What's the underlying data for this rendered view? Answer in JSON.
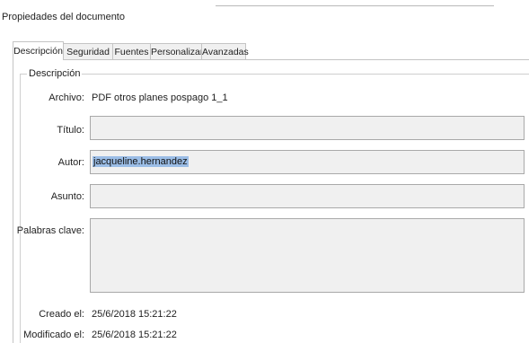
{
  "window": {
    "title": "Propiedades del documento"
  },
  "tabs": [
    {
      "label": "Descripción",
      "active": true
    },
    {
      "label": "Seguridad",
      "active": false
    },
    {
      "label": "Fuentes",
      "active": false
    },
    {
      "label": "Personalizar",
      "active": false
    },
    {
      "label": "Avanzadas",
      "active": false
    }
  ],
  "description": {
    "group_label": "Descripción",
    "archivo_label": "Archivo:",
    "archivo_value": "PDF otros planes pospago 1_1",
    "titulo_label": "Título:",
    "titulo_value": "",
    "autor_label": "Autor:",
    "autor_value": "jacqueline.hernandez",
    "asunto_label": "Asunto:",
    "asunto_value": "",
    "palabras_label": "Palabras clave:",
    "palabras_value": "",
    "creado_label": "Creado el:",
    "creado_value": "25/6/2018 15:21:22",
    "modificado_label": "Modificado el:",
    "modificado_value": "25/6/2018 15:21:22"
  },
  "colors": {
    "selection": "#9bbde6",
    "field_bg": "#f0f0f0",
    "border": "#a9a9a9"
  }
}
